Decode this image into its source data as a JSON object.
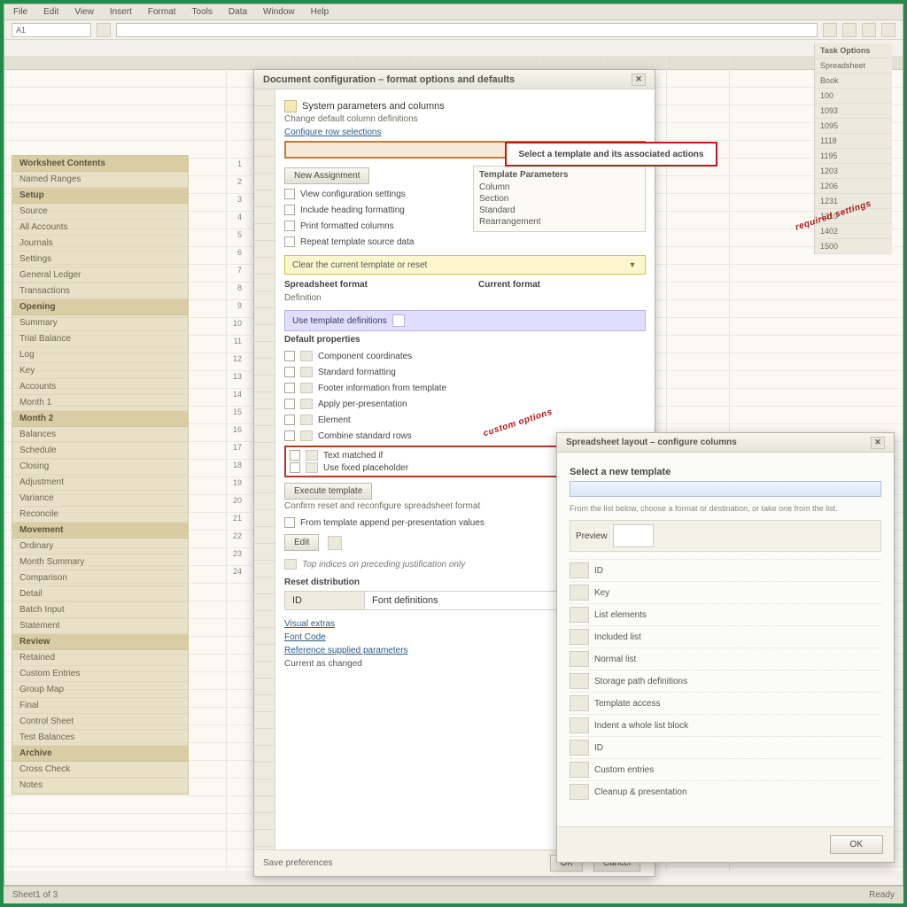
{
  "menubar": [
    "File",
    "Edit",
    "View",
    "Insert",
    "Format",
    "Tools",
    "Data",
    "Window",
    "Help"
  ],
  "namebox": "A1",
  "left_panel": {
    "header": "Worksheet Contents",
    "sub": "Named Ranges",
    "items": [
      "Setup",
      "Source",
      "All Accounts",
      "Journals",
      "Settings",
      "General Ledger",
      "Transactions",
      "Opening",
      "Summary",
      "Trial Balance",
      "Log",
      "Key",
      "Accounts",
      "Month 1",
      "Month 2",
      "Balances",
      "Schedule",
      "Closing",
      "Adjustment",
      "Variance",
      "Reconcile",
      "Movement",
      "Ordinary",
      "Month Summary",
      "Comparison",
      "Detail",
      "Batch Input",
      "Statement",
      "Review",
      "Retained",
      "Custom Entries",
      "Group Map",
      "Final",
      "Control Sheet",
      "Test Balances",
      "Archive",
      "Cross Check",
      "Notes"
    ]
  },
  "mid_col": [
    "1",
    "2",
    "3",
    "4",
    "5",
    "6",
    "7",
    "8",
    "9",
    "10",
    "11",
    "12",
    "13",
    "14",
    "15",
    "16",
    "17",
    "18",
    "19",
    "20",
    "21",
    "22",
    "23",
    "24"
  ],
  "right_panel": {
    "title": "Task Options",
    "section": "Spreadsheet",
    "items": [
      "Book",
      "100",
      "1093",
      "1095",
      "1118",
      "1195",
      "1203",
      "1206",
      "1231",
      "1310",
      "1402",
      "1500"
    ]
  },
  "callout": "Select a template and its associated actions",
  "dialog": {
    "title": "Document configuration – format options and defaults",
    "group1": {
      "head": "System parameters and columns",
      "sub": "Change default column definitions",
      "link": "Configure row selections"
    },
    "btn_new": "New Assignment",
    "opts1": [
      "View configuration settings",
      "Include heading formatting",
      "Print formatted columns",
      "Repeat template source data"
    ],
    "side_vals": {
      "head": "Template Parameters",
      "rows": [
        "Column",
        "Section",
        "Standard",
        "Rearrangement"
      ]
    },
    "yellow": "Clear the current template or reset",
    "group2": {
      "head": "Spreadsheet format",
      "sub": "Definition",
      "btn": "Use template definitions"
    },
    "opts2_head": "Default properties",
    "opts2": [
      "Component coordinates",
      "Standard formatting",
      "Footer information from template",
      "Apply per-presentation",
      "Element",
      "Combine standard rows",
      "Text matched if",
      "Use fixed placeholder"
    ],
    "btn_execute": "Execute template",
    "after_exec": "Confirm reset and reconfigure spreadsheet format",
    "after_chk": "From template append per-presentation values",
    "btn_edit": "Edit",
    "tip": "Top indices on preceding justification only",
    "group3": "Reset distribution",
    "sel": {
      "key": "ID",
      "val": "Font definitions"
    },
    "foot_links": [
      "Visual extras",
      "Font Code",
      "Reference supplied parameters",
      "Current as changed"
    ],
    "footer": {
      "left": "Save preferences",
      "ok": "OK",
      "cancel": "Cancel"
    }
  },
  "anno1": "required settings",
  "anno2": "custom options",
  "dialog2": {
    "title": "Spreadsheet layout – configure columns",
    "heading": "Select a new template",
    "hint": "From the list below, choose a format or destination, or take one from the list.",
    "panel_label": "Preview",
    "rows": [
      "ID",
      "Key",
      "List elements",
      "Included list",
      "Normal list",
      "Storage path definitions",
      "Template access",
      "Indent a whole list block",
      "ID",
      "Custom entries",
      "Cleanup & presentation"
    ],
    "ok": "OK"
  },
  "taskbar": {
    "left": "Sheet1 of 3",
    "right": "Ready"
  }
}
